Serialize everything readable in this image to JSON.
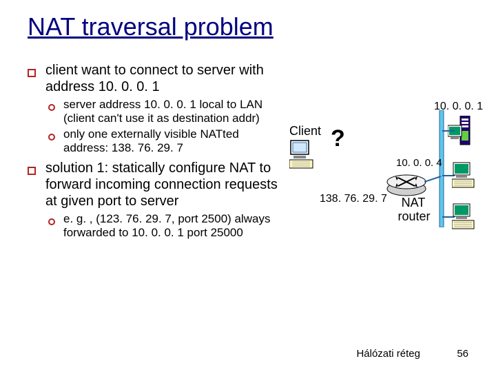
{
  "title": "NAT traversal problem",
  "bullets": {
    "b1": "client want to connect to server with address 10. 0. 0. 1",
    "b1a": "server address 10. 0. 0. 1 local to LAN (client can't use it as destination addr)",
    "b1b": "only one externally visible NATted address: 138. 76. 29. 7",
    "b2": "solution 1: statically configure NAT to forward incoming connection requests at given port to server",
    "b2a": "e. g. , (123. 76. 29. 7, port 2500) always forwarded to 10. 0. 0. 1 port 25000"
  },
  "diagram": {
    "client_label": "Client",
    "question": "?",
    "server_ip": "10. 0. 0. 1",
    "router_ip": "10. 0. 0. 4",
    "public_ip": "138. 76. 29. 7",
    "router_label1": "NAT",
    "router_label2": "router"
  },
  "footer": {
    "section": "Hálózati réteg",
    "page": "56"
  }
}
